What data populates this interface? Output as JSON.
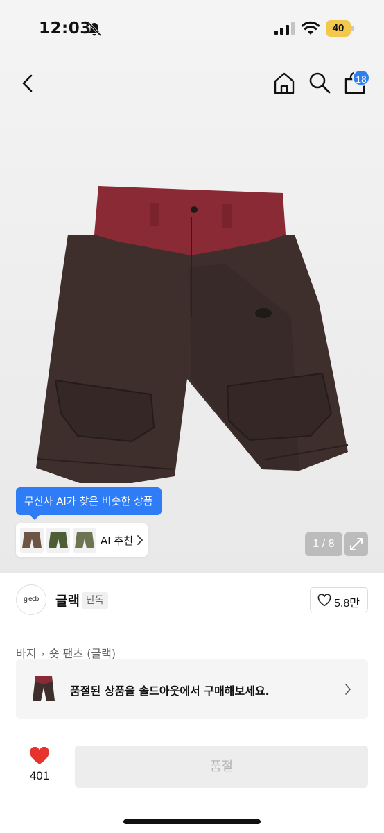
{
  "status_bar": {
    "time": "12:03",
    "battery": "40",
    "icons": [
      "bell-slash-icon",
      "cellular-signal-icon",
      "wifi-icon",
      "battery-icon"
    ]
  },
  "nav": {
    "icons": [
      "back-chevron-icon",
      "home-icon",
      "search-icon",
      "cart-icon"
    ],
    "cart_count": "18"
  },
  "gallery": {
    "current": "1",
    "total": "8",
    "counter": "1 / 8",
    "ai_tooltip": "무신사 AI가 찾은 비슷한 상품",
    "ai_label": "AI 추천",
    "thumbs": [
      "brown-shorts",
      "olive-shorts",
      "khaki-shorts"
    ]
  },
  "brand": {
    "logo_text": "glecb",
    "name": "글랙",
    "tag": "단독",
    "likes": "5.8만"
  },
  "breadcrumb": [
    "바지",
    "숏 팬츠 (글랙)"
  ],
  "soldout_banner": {
    "text": "품절된 상품을 솔드아웃에서 구매해보세요."
  },
  "bottom_bar": {
    "wish_count": "401",
    "buy_label": "품절"
  },
  "colors": {
    "accent": "#2f7df6",
    "badge": "#2f80ed",
    "heart": "#e8322d",
    "battery": "#f2c94c",
    "waistband": "#8a2a34",
    "shorts_body": "#3e2f2c"
  }
}
